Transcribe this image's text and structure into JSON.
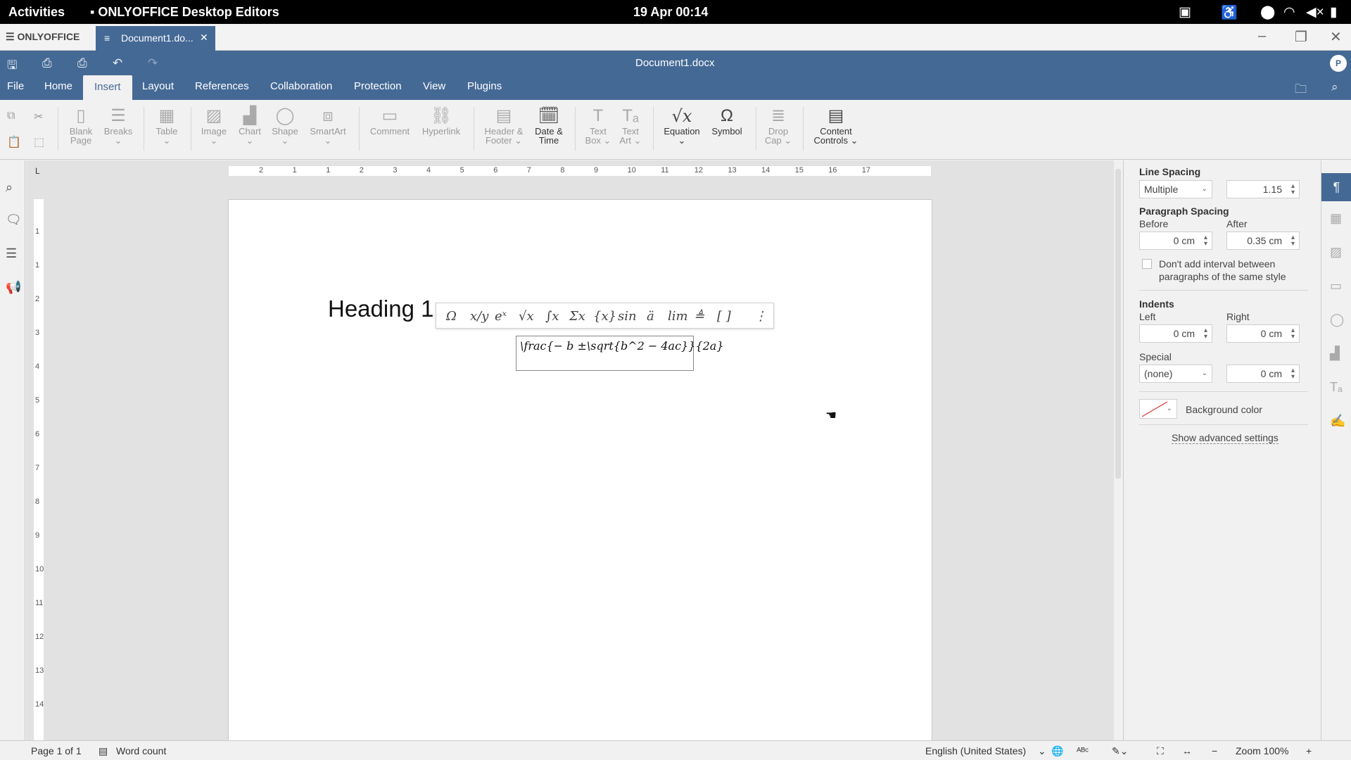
{
  "topbar": {
    "activities": "Activities",
    "app_name": "ONLYOFFICE Desktop Editors",
    "clock": "19 Apr  00:14",
    "tray_icons": [
      "clipboard-icon",
      "accessibility-icon",
      "location-icon",
      "wifi-icon",
      "volume-muted-icon",
      "battery-icon"
    ]
  },
  "tabbar": {
    "logo": "ONLYOFFICE",
    "doc_tab": "Document1.do...",
    "close": "✕"
  },
  "header": {
    "title": "Document1.docx",
    "avatar": "P",
    "menu": [
      "File",
      "Home",
      "Insert",
      "Layout",
      "References",
      "Collaboration",
      "Protection",
      "View",
      "Plugins"
    ],
    "active_menu": "Insert"
  },
  "ribbon": {
    "blank_page": [
      "Blank",
      "Page"
    ],
    "breaks": "Breaks",
    "table": "Table",
    "image": "Image",
    "chart": "Chart",
    "shape": "Shape",
    "smartart": "SmartArt",
    "comment": "Comment",
    "hyperlink": "Hyperlink",
    "header_footer": [
      "Header &",
      "Footer"
    ],
    "date_time": [
      "Date &",
      "Time"
    ],
    "text_box": [
      "Text",
      "Box"
    ],
    "text_art": [
      "Text",
      "Art"
    ],
    "equation": "Equation",
    "symbol": "Symbol",
    "drop_cap": [
      "Drop",
      "Cap"
    ],
    "content_controls": [
      "Content",
      "Controls"
    ]
  },
  "ruler": {
    "h_numbers": [
      "2",
      "1",
      "1",
      "2",
      "3",
      "4",
      "5",
      "6",
      "7",
      "8",
      "9",
      "10",
      "11",
      "12",
      "13",
      "14",
      "15",
      "16",
      "17"
    ],
    "v_numbers": [
      "1",
      "1",
      "2",
      "3",
      "4",
      "5",
      "6",
      "7",
      "8",
      "9",
      "10",
      "11",
      "12",
      "13",
      "14"
    ]
  },
  "document": {
    "heading": "Heading 1",
    "equation": "\\frac{− b ±\\sqrt{b^2 − 4ac}}{2a}",
    "eq_toolbar": [
      "Ω",
      "x/y",
      "eˣ",
      "√x",
      "∫x",
      "Σx",
      "{x}",
      "sin",
      "ä",
      "lim",
      "≜",
      "[ ]",
      "⋮"
    ]
  },
  "settings": {
    "line_spacing_label": "Line Spacing",
    "line_spacing_mode": "Multiple",
    "line_spacing_value": "1.15",
    "paragraph_spacing_label": "Paragraph Spacing",
    "before_label": "Before",
    "before_value": "0 cm",
    "after_label": "After",
    "after_value": "0.35 cm",
    "dont_add_interval": "Don't add interval between paragraphs of the same style",
    "indents_label": "Indents",
    "left_label": "Left",
    "left_value": "0 cm",
    "right_label": "Right",
    "right_value": "0 cm",
    "special_label": "Special",
    "special_value": "(none)",
    "special_amount": "0 cm",
    "background_color_label": "Background color",
    "show_advanced": "Show advanced settings"
  },
  "status": {
    "page": "Page 1 of 1",
    "word_count": "Word count",
    "language": "English (United States)",
    "zoom": "Zoom 100%"
  }
}
